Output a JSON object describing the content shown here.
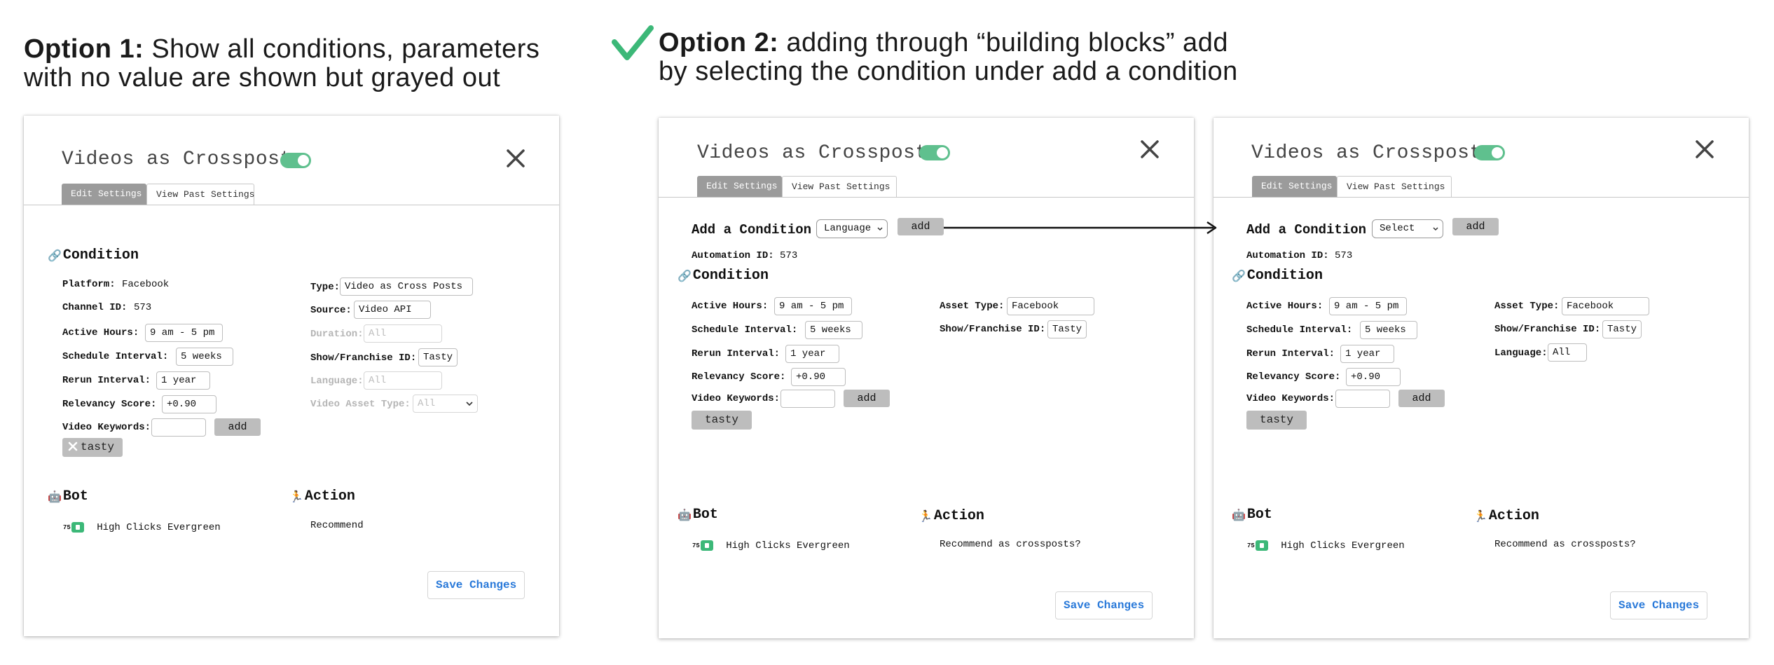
{
  "option1": {
    "prefix": "Option 1:",
    "line1": " Show all conditions, parameters",
    "line2": "with no value are shown but grayed out"
  },
  "option2": {
    "prefix": "Option 2:",
    "line1": " adding through “building blocks” add",
    "line2": "by selecting the condition under add a condition"
  },
  "icons": {
    "check": "checkmark-icon",
    "close": "close-icon",
    "condition": "link-icon",
    "bot": "robot-icon",
    "action": "running-person-icon",
    "tag_remove": "x-icon",
    "dropdown": "chevron-down-icon"
  },
  "colors": {
    "toggle": "#5fc08e",
    "check": "#3cb878",
    "link": "#2979d9",
    "active_tab": "#9b9b9b",
    "button": "#bdbdbd"
  },
  "panel1": {
    "title": "Videos as Crossposts",
    "tabs": [
      "Edit Settings",
      "View Past Settings"
    ],
    "condition_title": "Condition",
    "platform_label": "Platform:",
    "platform_value": "Facebook",
    "channel_label": "Channel ID:",
    "channel_value": "573",
    "active_hours_label": "Active Hours:",
    "active_hours_value": "9 am - 5 pm",
    "schedule_label": "Schedule Interval:",
    "schedule_value": "5 weeks",
    "rerun_label": "Rerun Interval:",
    "rerun_value": "1 year",
    "relevancy_label": "Relevancy Score:",
    "relevancy_value": "+0.90",
    "keywords_label": "Video Keywords:",
    "add_label": "add",
    "tag": "tasty",
    "type_label": "Type:",
    "type_value": "Video as Cross Posts",
    "source_label": "Source:",
    "source_value": "Video API",
    "duration_label": "Duration:",
    "duration_placeholder": "All",
    "show_label": "Show/Franchise ID:",
    "show_value": "Tasty",
    "language_label": "Language:",
    "language_placeholder": "All",
    "asset_type_label": "Video Asset Type:",
    "asset_type_value": "All",
    "bot_title": "Bot",
    "bot_badge": "75",
    "bot_name": "High Clicks Evergreen",
    "action_title": "Action",
    "action_value": "Recommend",
    "save": "Save Changes"
  },
  "panel2": {
    "title": "Videos as Crossposts",
    "tabs": [
      "Edit Settings",
      "View Past Settings"
    ],
    "add_condition_label": "Add a Condition",
    "select_value": "Language",
    "add_label": "add",
    "automation_label": "Automation ID:",
    "automation_value": "573",
    "condition_title": "Condition",
    "active_hours_label": "Active Hours:",
    "active_hours_value": "9 am - 5 pm",
    "schedule_label": "Schedule Interval:",
    "schedule_value": "5 weeks",
    "rerun_label": "Rerun Interval:",
    "rerun_value": "1 year",
    "relevancy_label": "Relevancy Score:",
    "relevancy_value": "+0.90",
    "keywords_label": "Video Keywords:",
    "tag": "tasty",
    "asset_type_label": "Asset Type:",
    "asset_type_value": "Facebook",
    "show_label": "Show/Franchise ID:",
    "show_value": "Tasty",
    "bot_title": "Bot",
    "bot_badge": "75",
    "bot_name": "High Clicks Evergreen",
    "action_title": "Action",
    "action_value": "Recommend as crossposts?",
    "save": "Save Changes"
  },
  "panel3": {
    "title": "Videos as Crossposts",
    "tabs": [
      "Edit Settings",
      "View Past Settings"
    ],
    "add_condition_label": "Add a Condition",
    "select_value": "Select",
    "add_label": "add",
    "automation_label": "Automation ID:",
    "automation_value": "573",
    "condition_title": "Condition",
    "active_hours_label": "Active Hours:",
    "active_hours_value": "9 am - 5 pm",
    "schedule_label": "Schedule Interval:",
    "schedule_value": "5 weeks",
    "rerun_label": "Rerun Interval:",
    "rerun_value": "1 year",
    "relevancy_label": "Relevancy Score:",
    "relevancy_value": "+0.90",
    "keywords_label": "Video Keywords:",
    "tag": "tasty",
    "asset_type_label": "Asset Type:",
    "asset_type_value": "Facebook",
    "show_label": "Show/Franchise ID:",
    "show_value": "Tasty",
    "language_label": "Language:",
    "language_value": "All",
    "bot_title": "Bot",
    "bot_badge": "75",
    "bot_name": "High Clicks Evergreen",
    "action_title": "Action",
    "action_value": "Recommend as crossposts?",
    "save": "Save Changes"
  }
}
